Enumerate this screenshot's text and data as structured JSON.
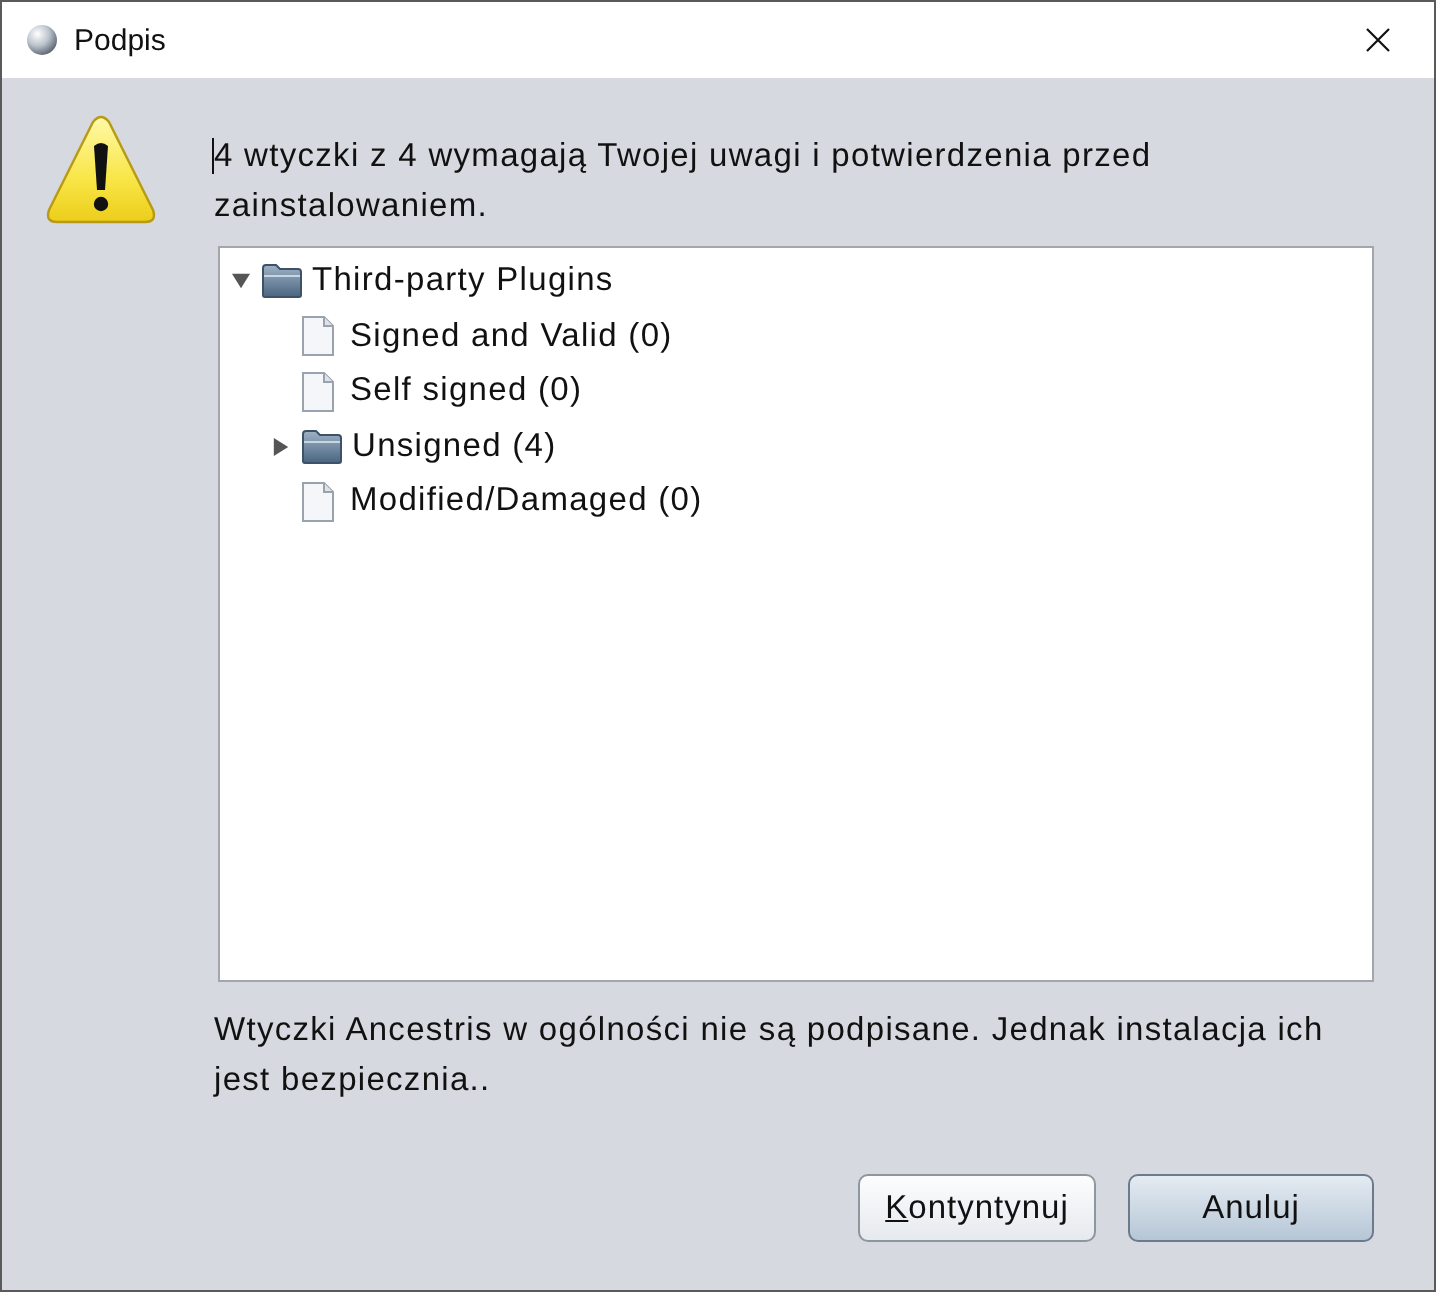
{
  "window": {
    "title": "Podpis"
  },
  "message": {
    "text": "4 wtyczki z 4 wymagają Twojej uwagi i potwierdzenia przed zainstalowaniem.",
    "caret": true
  },
  "tree": {
    "items": [
      {
        "label": "Third-party Plugins",
        "kind": "folder",
        "expanded": true,
        "children": [
          {
            "label": "Signed and Valid (0)",
            "kind": "file"
          },
          {
            "label": "Self signed (0)",
            "kind": "file"
          },
          {
            "label": "Unsigned (4)",
            "kind": "folder",
            "expanded": false
          },
          {
            "label": "Modified/Damaged (0)",
            "kind": "file"
          }
        ]
      }
    ]
  },
  "note": "Wtyczki Ancestris w ogólności nie są podpisane. Jednak instalacja ich jest bezpiecznia..",
  "buttons": [
    {
      "label": "Kontyntynuj",
      "mnemonic_underline": true,
      "default": false
    },
    {
      "label": "Anuluj",
      "mnemonic_underline": false,
      "default": true
    }
  ]
}
